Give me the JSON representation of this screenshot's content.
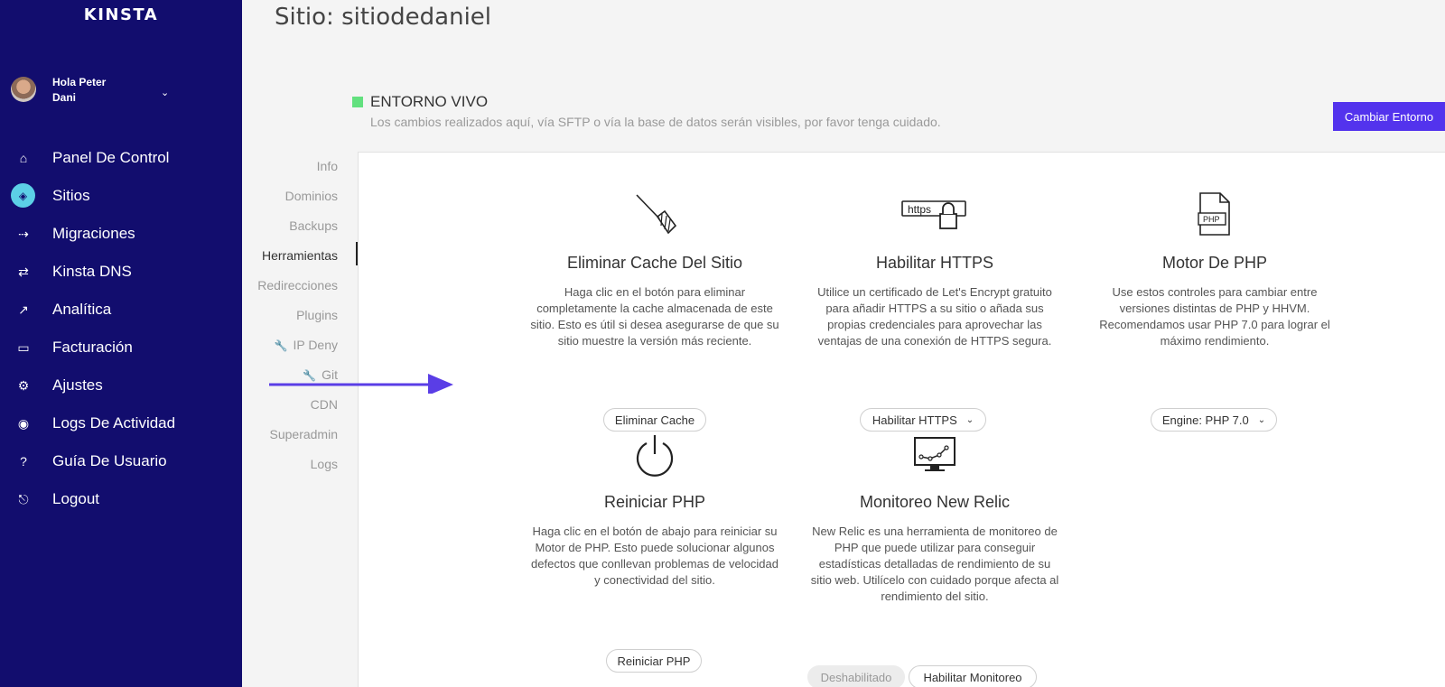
{
  "brand": {
    "logo_text": "KINSTA"
  },
  "user": {
    "greeting": "Hola Peter",
    "name": "Dani"
  },
  "nav": [
    {
      "label": "Panel De Control",
      "icon": "home-icon",
      "glyph": "⌂",
      "active": false
    },
    {
      "label": "Sitios",
      "icon": "sites-icon",
      "glyph": "◈",
      "active": true
    },
    {
      "label": "Migraciones",
      "icon": "migrations-icon",
      "glyph": "⇢",
      "active": false
    },
    {
      "label": "Kinsta DNS",
      "icon": "dns-icon",
      "glyph": "⇄",
      "active": false
    },
    {
      "label": "Analítica",
      "icon": "analytics-icon",
      "glyph": "↗",
      "active": false
    },
    {
      "label": "Facturación",
      "icon": "billing-icon",
      "glyph": "▭",
      "active": false
    },
    {
      "label": "Ajustes",
      "icon": "settings-icon",
      "glyph": "⚙",
      "active": false
    },
    {
      "label": "Logs De Actividad",
      "icon": "eye-icon",
      "glyph": "◉",
      "active": false
    },
    {
      "label": "Guía De Usuario",
      "icon": "help-icon",
      "glyph": "?",
      "active": false
    },
    {
      "label": "Logout",
      "icon": "logout-icon",
      "glyph": "⎋",
      "active": false
    }
  ],
  "page": {
    "title": "Sitio: sitiodedaniel"
  },
  "environment": {
    "title": "ENTORNO VIVO",
    "description": "Los cambios realizados aquí, vía SFTP o vía la base de datos serán visibles, por favor tenga cuidado.",
    "switch_label": "Cambiar Entorno",
    "status_color": "#62e07e"
  },
  "subnav": [
    {
      "label": "Info",
      "active": false,
      "wrench": false
    },
    {
      "label": "Dominios",
      "active": false,
      "wrench": false
    },
    {
      "label": "Backups",
      "active": false,
      "wrench": false
    },
    {
      "label": "Herramientas",
      "active": true,
      "wrench": false
    },
    {
      "label": "Redirecciones",
      "active": false,
      "wrench": false
    },
    {
      "label": "Plugins",
      "active": false,
      "wrench": false
    },
    {
      "label": "IP Deny",
      "active": false,
      "wrench": true
    },
    {
      "label": "Git",
      "active": false,
      "wrench": true
    },
    {
      "label": "CDN",
      "active": false,
      "wrench": false
    },
    {
      "label": "Superadmin",
      "active": false,
      "wrench": false
    },
    {
      "label": "Logs",
      "active": false,
      "wrench": false
    }
  ],
  "tools": {
    "cache": {
      "title": "Eliminar Cache Del Sitio",
      "description": "Haga clic en el botón para eliminar completamente la cache almacenada de este sitio. Esto es útil si desea asegurarse de que su sitio muestre la versión más reciente.",
      "button": "Eliminar Cache"
    },
    "https": {
      "icon_text": "https",
      "title": "Habilitar HTTPS",
      "description": "Utilice un certificado de Let's Encrypt gratuito para añadir HTTPS a su sitio o añada sus propias credenciales para aprovechar las ventajas de una conexión de HTTPS segura.",
      "button": "Habilitar HTTPS"
    },
    "php_engine": {
      "icon_text": "PHP",
      "title": "Motor De PHP",
      "description": "Use estos controles para cambiar entre versiones distintas de PHP y HHVM. Recomendamos usar PHP 7.0 para lograr el máximo rendimiento.",
      "button": "Engine: PHP 7.0"
    },
    "restart_php": {
      "title": "Reiniciar PHP",
      "description": "Haga clic en el botón de abajo para reiniciar su Motor de PHP. Esto puede solucionar algunos defectos que conllevan problemas de velocidad y conectividad del sitio.",
      "button": "Reiniciar PHP"
    },
    "new_relic": {
      "title": "Monitoreo New Relic",
      "description": "New Relic es una herramienta de monitoreo de PHP que puede utilizar para conseguir estadísticas detalladas de rendimiento de su sitio web. Utilícelo con cuidado porque afecta al rendimiento del sitio.",
      "status": "Deshabilitado",
      "button": "Habilitar Monitoreo"
    }
  },
  "colors": {
    "sidebar": "#120d6e",
    "accent": "#5333ed",
    "active_icon": "#5ccfe6"
  }
}
